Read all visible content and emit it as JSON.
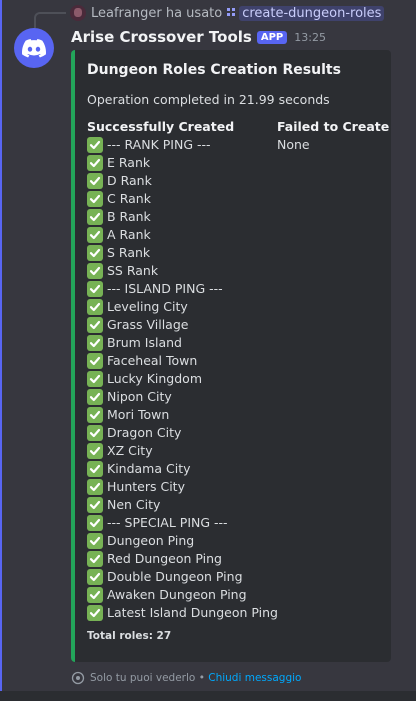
{
  "reply": {
    "user": "Leafranger",
    "action": "ha usato",
    "command": "create-dungeon-roles"
  },
  "message": {
    "bot_name": "Arise Crossover Tools",
    "badge": "APP",
    "time": "13:25"
  },
  "embed": {
    "accent_color": "#23a55a",
    "title": "Dungeon Roles Creation Results",
    "description": "Operation completed in 21.99 seconds",
    "success_field_name": "Successfully Created",
    "failed_field_name": "Failed to Create",
    "failed_value": "None",
    "check_icon": "white-check-mark",
    "roles": [
      "--- RANK PING ---",
      "E Rank",
      "D Rank",
      "C Rank",
      "B Rank",
      "A Rank",
      "S Rank",
      "SS Rank",
      "--- ISLAND PING ---",
      "Leveling City",
      "Grass Village",
      "Brum Island",
      "Faceheal Town",
      "Lucky Kingdom",
      "Nipon City",
      "Mori Town",
      "Dragon City",
      "XZ City",
      "Kindama City",
      "Hunters City",
      "Nen City",
      "--- SPECIAL PING ---",
      "Dungeon Ping",
      "Red Dungeon Ping",
      "Double Dungeon Ping",
      "Awaken Dungeon Ping",
      "Latest Island Dungeon Ping"
    ],
    "footer": "Total roles: 27"
  },
  "ephemeral": {
    "note": "Solo tu puoi vederlo",
    "separator": "•",
    "dismiss": "Chiudi messaggio"
  }
}
